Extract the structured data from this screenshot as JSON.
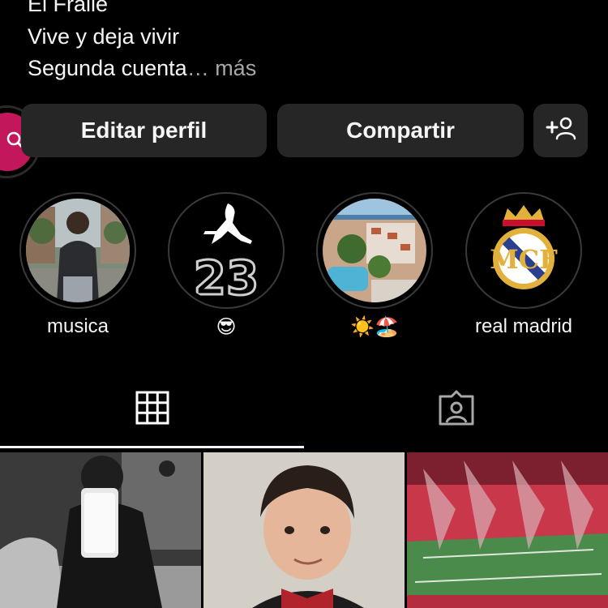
{
  "bio": {
    "line1": "El Fraile",
    "line2": "Vive y deja vivir",
    "line3": "Segunda cuenta",
    "ellipsis": "…",
    "more": " más"
  },
  "actions": {
    "edit_profile": "Editar perfil",
    "share": "Compartir",
    "discover_people_icon": "add-person-icon"
  },
  "highlights": [
    {
      "label": "musica",
      "icon": "person-photo"
    },
    {
      "label": "😎",
      "icon": "jumpman-23-logo"
    },
    {
      "label": "☀️🏖️",
      "icon": "resort-photo"
    },
    {
      "label": "real madrid",
      "icon": "real-madrid-crest"
    }
  ],
  "tabs": [
    {
      "icon": "grid-icon",
      "active": true
    },
    {
      "icon": "tagged-person-icon",
      "active": false
    }
  ],
  "colors": {
    "background": "#000000",
    "button": "#262626",
    "accent": "#c2185b",
    "muted_text": "#a8a8a8"
  }
}
